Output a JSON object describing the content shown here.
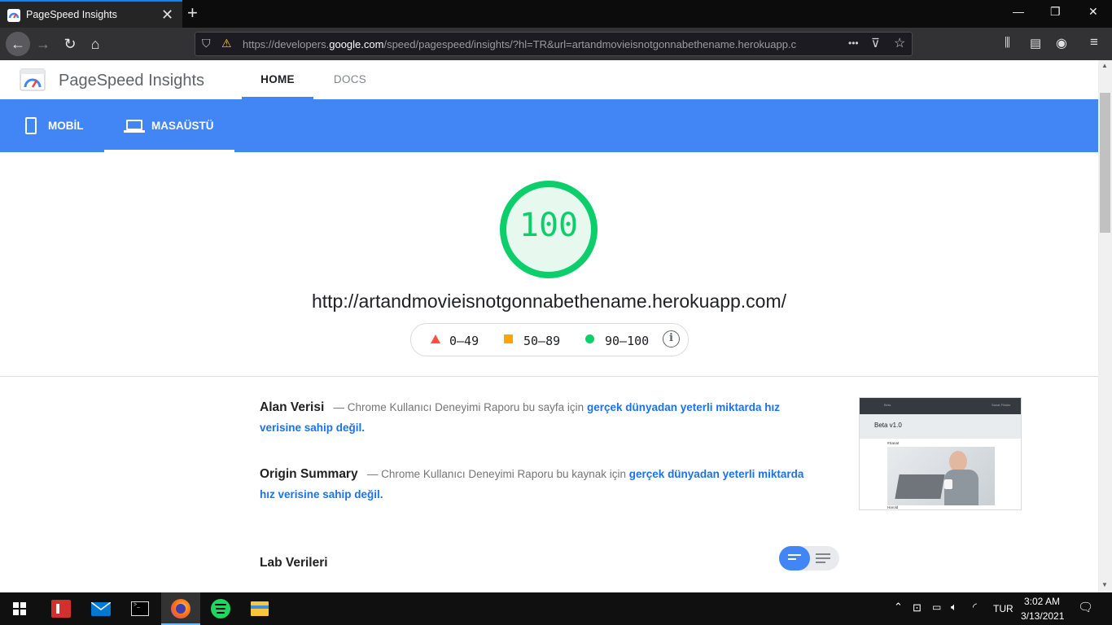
{
  "browser": {
    "tab_title": "PageSpeed Insights",
    "new_tab": "+",
    "url_prefix": "https://developers.",
    "url_host": "google.com",
    "url_rest": "/speed/pagespeed/insights/?hl=TR&url=artandmovieisnotgonnabethename.herokuapp.co",
    "url_more": "•••",
    "window_controls": [
      "minimize",
      "restore",
      "close"
    ]
  },
  "app": {
    "title": "PageSpeed Insights",
    "tabs": [
      {
        "label": "HOME",
        "active": true
      },
      {
        "label": "DOCS",
        "active": false
      }
    ],
    "device_tabs": [
      {
        "label": "MOBİL",
        "icon": "phone-icon",
        "active": false
      },
      {
        "label": "MASAÜSTÜ",
        "icon": "laptop-icon",
        "active": true
      }
    ],
    "accent_color": "#4285f4"
  },
  "report": {
    "score": "100",
    "score_fraction": 1.0,
    "score_color": "#0cce6b",
    "url": "http://artandmovieisnotgonnabethename.herokuapp.com/",
    "legend": [
      {
        "range": "0–49",
        "color": "#ff4e42",
        "icon": "triangle-icon"
      },
      {
        "range": "50–89",
        "color": "#ffa400",
        "icon": "square-icon"
      },
      {
        "range": "90–100",
        "color": "#0cce6b",
        "icon": "circle-icon"
      }
    ],
    "field_data": {
      "title": "Alan Verisi",
      "dash": "—",
      "text": "Chrome Kullanıcı Deneyimi Raporu bu sayfa için",
      "link": "gerçek dünyadan yeterli miktarda hız verisine sahip değil."
    },
    "origin_summary": {
      "title": "Origin Summary",
      "dash": "—",
      "text": "Chrome Kullanıcı Deneyimi Raporu bu kaynak için",
      "link": "gerçek dünyadan yeterli miktarda hız verisine sahip değil."
    },
    "screenshot": {
      "nav_left": "Beta",
      "nav_right": "Sanat   Filmler",
      "heading": "Beta v1.0",
      "tag": "#Sanat",
      "caption": "Harold"
    },
    "lab_title": "Lab Verileri"
  },
  "taskbar": {
    "language": "TUR",
    "time": "3:02 AM",
    "date": "3/13/2021"
  }
}
